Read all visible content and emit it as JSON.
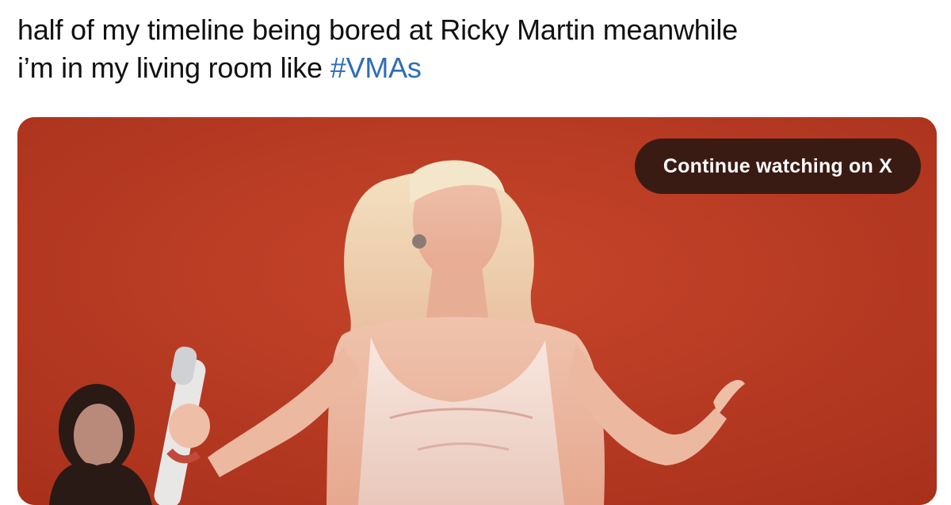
{
  "tweet": {
    "text_line1": "half of my timeline being bored at Ricky Martin meanwhile",
    "text_line2_prefix": "i’m in my living room like ",
    "hashtag": "#VMAs"
  },
  "media": {
    "type": "video",
    "overlay_button_label": "Continue watching on X",
    "accent_color": "#b5361f"
  },
  "icons": {
    "microphone": "microphone-icon"
  }
}
